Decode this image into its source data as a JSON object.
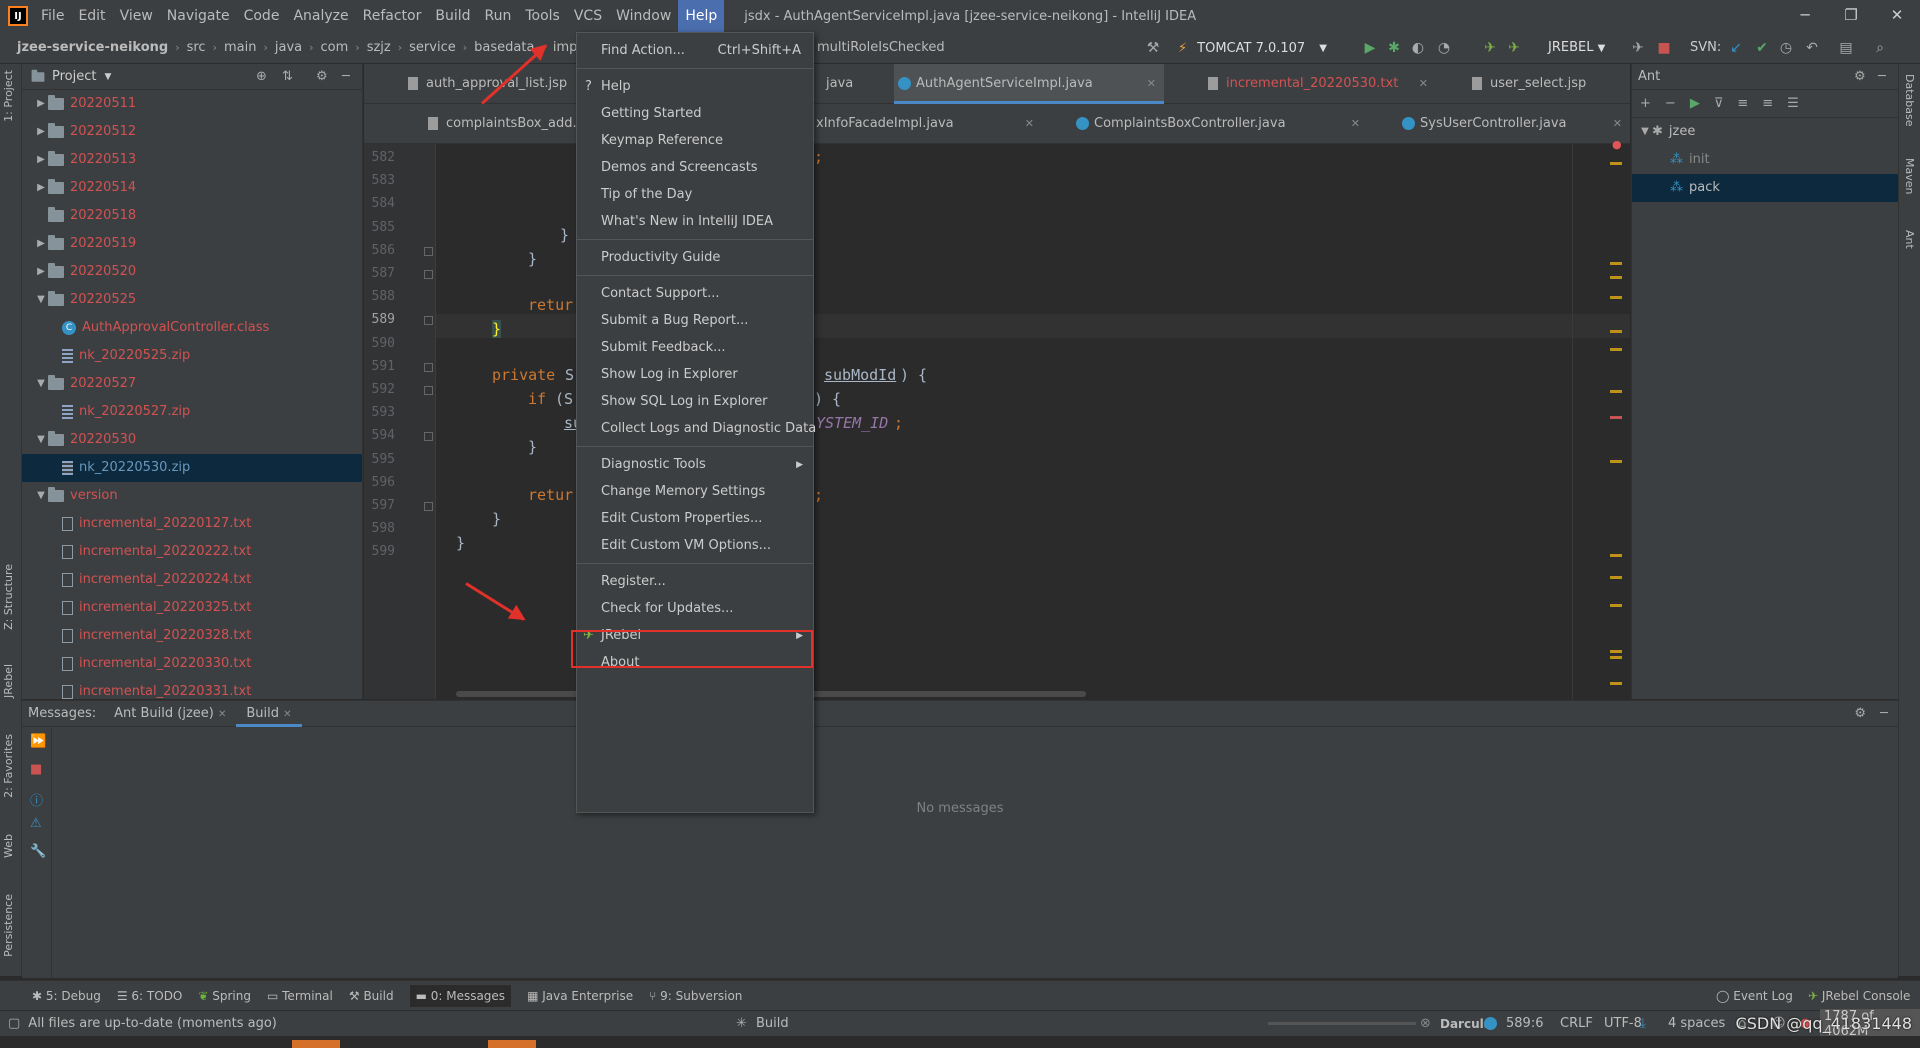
{
  "window": {
    "title": "jsdx - AuthAgentServiceImpl.java [jzee-service-neikong] - IntelliJ IDEA",
    "minimize": "─",
    "restore": "❐",
    "close": "✕"
  },
  "menubar": [
    "File",
    "Edit",
    "View",
    "Navigate",
    "Code",
    "Analyze",
    "Refactor",
    "Build",
    "Run",
    "Tools",
    "VCS",
    "Window",
    "Help"
  ],
  "breadcrumbs": [
    "jzee-service-neikong",
    "src",
    "main",
    "java",
    "com",
    "szjz",
    "service",
    "basedata",
    "impl",
    "auth"
  ],
  "breadcrumb_tail": "multiRoleIsChecked",
  "run_config": "TOMCAT 7.0.107",
  "jrebel_select": "JREBEL",
  "svn_label": "SVN:",
  "project": {
    "title": "Project",
    "tree": [
      {
        "label": "20220511",
        "type": "folder",
        "level": 1,
        "expanded": false,
        "color": "red"
      },
      {
        "label": "20220512",
        "type": "folder",
        "level": 1,
        "expanded": false,
        "color": "red"
      },
      {
        "label": "20220513",
        "type": "folder",
        "level": 1,
        "expanded": false,
        "color": "red"
      },
      {
        "label": "20220514",
        "type": "folder",
        "level": 1,
        "expanded": false,
        "color": "red"
      },
      {
        "label": "20220518",
        "type": "folder",
        "level": 1,
        "expanded": null,
        "color": "red"
      },
      {
        "label": "20220519",
        "type": "folder",
        "level": 1,
        "expanded": false,
        "color": "red"
      },
      {
        "label": "20220520",
        "type": "folder",
        "level": 1,
        "expanded": false,
        "color": "red"
      },
      {
        "label": "20220525",
        "type": "folder",
        "level": 1,
        "expanded": true,
        "color": "red"
      },
      {
        "label": "AuthApprovalController.class",
        "type": "class",
        "level": 2,
        "color": "red"
      },
      {
        "label": "nk_20220525.zip",
        "type": "zip",
        "level": 2,
        "color": "red"
      },
      {
        "label": "20220527",
        "type": "folder",
        "level": 1,
        "expanded": true,
        "color": "red"
      },
      {
        "label": "nk_20220527.zip",
        "type": "zip",
        "level": 2,
        "color": "red"
      },
      {
        "label": "20220530",
        "type": "folder",
        "level": 1,
        "expanded": true,
        "color": "red"
      },
      {
        "label": "nk_20220530.zip",
        "type": "zip",
        "level": 2,
        "color": "blue",
        "selected": true
      },
      {
        "label": "version",
        "type": "folder",
        "level": 1,
        "expanded": true,
        "color": "red"
      },
      {
        "label": "incremental_20220127.txt",
        "type": "file",
        "level": 2,
        "color": "red"
      },
      {
        "label": "incremental_20220222.txt",
        "type": "file",
        "level": 2,
        "color": "red"
      },
      {
        "label": "incremental_20220224.txt",
        "type": "file",
        "level": 2,
        "color": "red"
      },
      {
        "label": "incremental_20220325.txt",
        "type": "file",
        "level": 2,
        "color": "red"
      },
      {
        "label": "incremental_20220328.txt",
        "type": "file",
        "level": 2,
        "color": "red"
      },
      {
        "label": "incremental_20220330.txt",
        "type": "file",
        "level": 2,
        "color": "red"
      },
      {
        "label": "incremental_20220331.txt",
        "type": "file",
        "level": 2,
        "color": "red"
      }
    ]
  },
  "editor_tabs_row1": [
    "auth_approval_list.jsp",
    "java",
    "AuthAgentServiceImpl.java",
    "incremental_20220530.txt",
    "user_select.jsp"
  ],
  "editor_tabs_row2": [
    "complaintsBox_add.jsp",
    "xInfoFacadeImpl.java",
    "ComplaintsBoxController.java",
    "SysUserController.java"
  ],
  "code": {
    "line_numbers": [
      "582",
      "583",
      "584",
      "585",
      "586",
      "587",
      "588",
      "589",
      "590",
      "591",
      "592",
      "593",
      "594",
      "595",
      "596",
      "597",
      "598",
      "599"
    ],
    "current_line": "589",
    "l582": ";",
    "l585": "}",
    "l586": "}",
    "l588": "retur",
    "l589": "}",
    "l591_kw": "private",
    "l591_a": " S",
    "l591_b": "subModId",
    "l591_c": ") {",
    "l592_kw": "if",
    "l592_a": " (S",
    "l592_b": ") {",
    "l593_a": "su",
    "l593_b": "YSTEM_ID",
    "l593_c": ";",
    "l594": "}",
    "l596": "retur",
    "l596_b": ";",
    "l597": "}",
    "l598": "}"
  },
  "ant": {
    "title": "Ant",
    "items": [
      "jzee",
      "init",
      "pack"
    ]
  },
  "bottom": {
    "label": "Messages:",
    "tabs": [
      "Ant Build (jzee)",
      "Build"
    ],
    "empty_text": "No messages"
  },
  "toolwindows": [
    "5: Debug",
    "6: TODO",
    "Spring",
    "Terminal",
    "Build",
    "0: Messages",
    "Java Enterprise",
    "9: Subversion"
  ],
  "toolwindows_right": [
    "Event Log",
    "JRebel Console"
  ],
  "left_strip": [
    "1: Project",
    "Z: Structure",
    "JRebel",
    "2: Favorites",
    "Web",
    "Persistence"
  ],
  "right_strip": [
    "Database",
    "Maven",
    "Ant"
  ],
  "status": {
    "message": "All files are up-to-date (moments ago)",
    "task": "Build",
    "theme": "Darcula",
    "position": "589:6",
    "line_sep": "CRLF",
    "encoding": "UTF-8",
    "indent": "4 spaces",
    "memory": "1787 of 4062M"
  },
  "help_menu": {
    "items": [
      {
        "label": "Find Action...",
        "shortcut": "Ctrl+Shift+A"
      },
      {
        "sep": true
      },
      {
        "label": "Help",
        "icon": "?"
      },
      {
        "label": "Getting Started"
      },
      {
        "label": "Keymap Reference"
      },
      {
        "label": "Demos and Screencasts"
      },
      {
        "label": "Tip of the Day"
      },
      {
        "label": "What's New in IntelliJ IDEA"
      },
      {
        "sep": true
      },
      {
        "label": "Productivity Guide"
      },
      {
        "sep": true
      },
      {
        "label": "Contact Support..."
      },
      {
        "label": "Submit a Bug Report..."
      },
      {
        "label": "Submit Feedback..."
      },
      {
        "label": "Show Log in Explorer"
      },
      {
        "label": "Show SQL Log in Explorer"
      },
      {
        "label": "Collect Logs and Diagnostic Data"
      },
      {
        "sep": true
      },
      {
        "label": "Diagnostic Tools",
        "submenu": true
      },
      {
        "label": "Change Memory Settings"
      },
      {
        "label": "Edit Custom Properties..."
      },
      {
        "label": "Edit Custom VM Options...",
        "highlighted": true
      },
      {
        "sep": true
      },
      {
        "label": "Register..."
      },
      {
        "label": "Check for Updates..."
      },
      {
        "label": "JRebel",
        "submenu": true,
        "icon": "jrebel"
      },
      {
        "label": "About"
      }
    ]
  },
  "watermark": "CSDN @qq_41831448",
  "colors": {
    "accent": "#4a88c7",
    "vcs_new": "#d25252",
    "annotation": "#e0312a",
    "selection": "#0d293e"
  }
}
